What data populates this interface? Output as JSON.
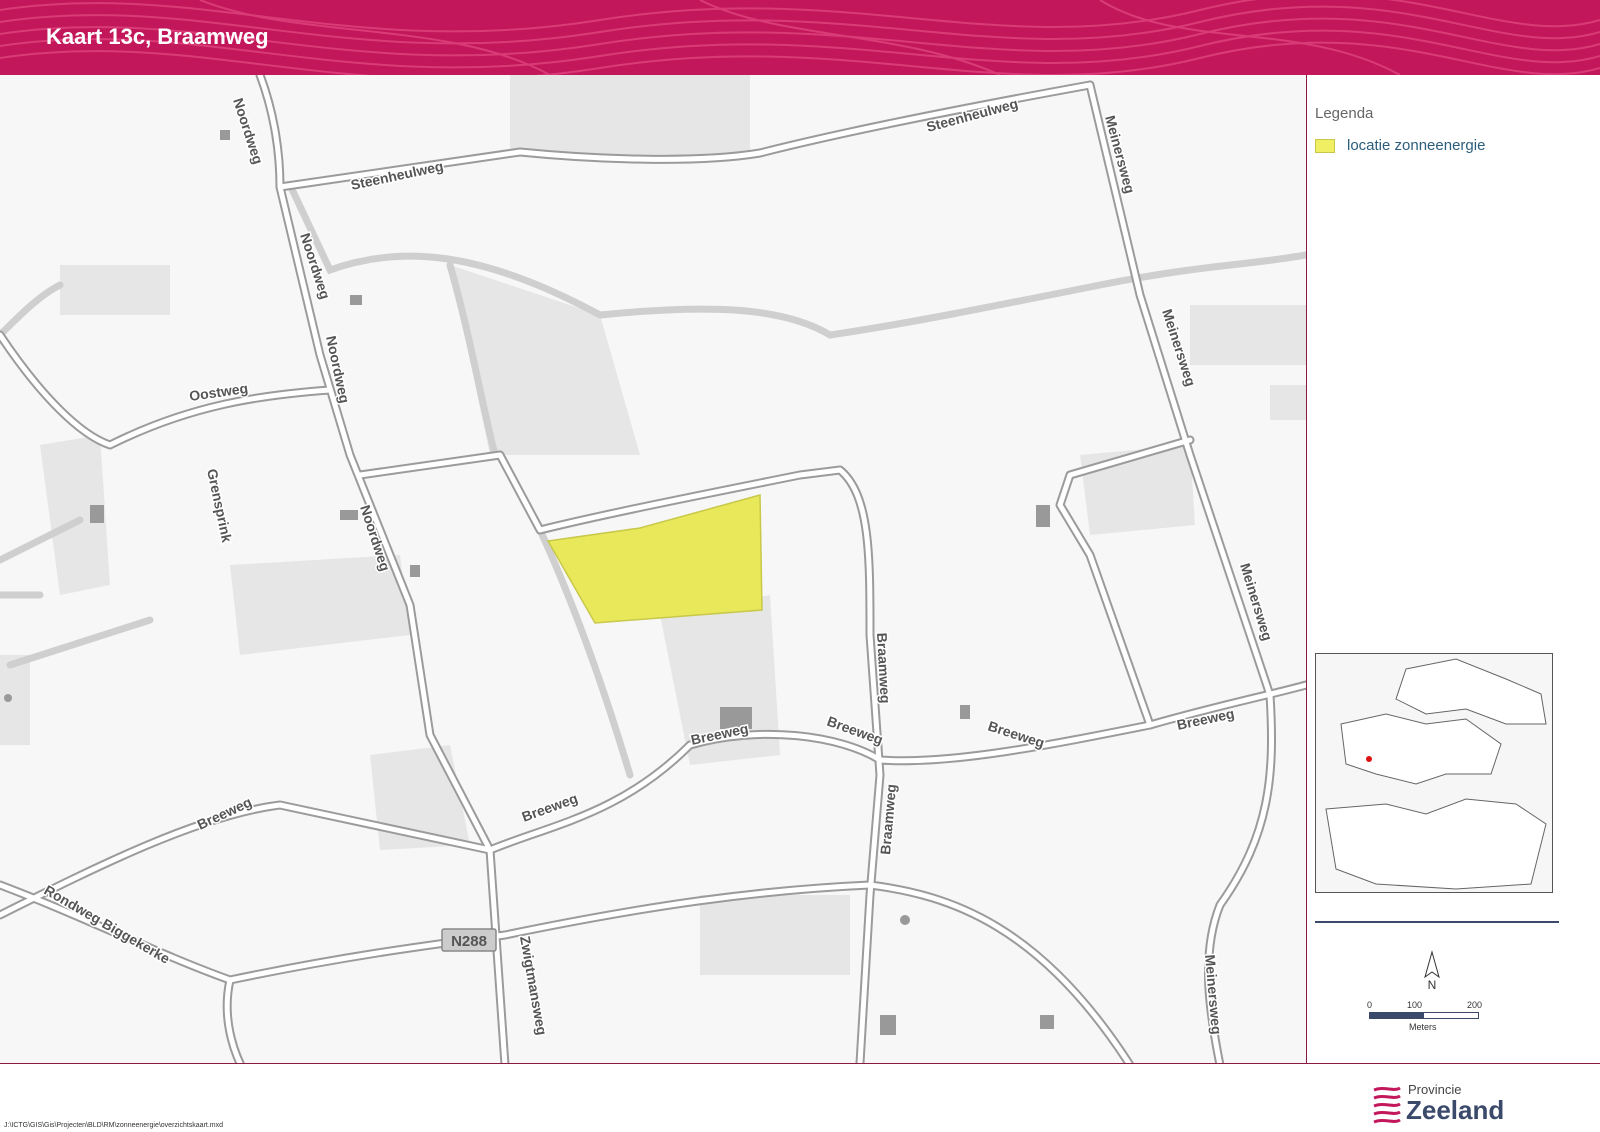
{
  "header": {
    "title": "Kaart 13c, Braamweg"
  },
  "map": {
    "road_labels": [
      "Steenheulweg",
      "Steenheulweg",
      "Noordweg",
      "Noordweg",
      "Noordweg",
      "Noordweg",
      "Oostweg",
      "Grensprink",
      "Meinersweg",
      "Meinersweg",
      "Meinersweg",
      "Meinersweg",
      "Braamweg",
      "Braamweg",
      "Breeweg",
      "Breeweg",
      "Breeweg",
      "Breeweg",
      "Breeweg",
      "Breeweg",
      "Rondweg Biggekerke",
      "Zwigtmansweg",
      "N288"
    ],
    "highlight_color": "#e8e85a"
  },
  "legend": {
    "title": "Legenda",
    "item_label": "locatie zonneenergie",
    "item_color": "#f0ef63"
  },
  "north": {
    "label": "N"
  },
  "scale": {
    "ticks": [
      "0",
      "100",
      "200"
    ],
    "units": "Meters"
  },
  "footer": {
    "filepath": "J:\\ICTG\\GIS\\Gis\\Projecten\\BLD\\RM\\zonneenergie\\overzichtskaart.mxd"
  },
  "logo": {
    "provincie": "Provincie",
    "name": "Zeeland"
  },
  "colors": {
    "header": "#c2185b",
    "border": "#8a1a44"
  }
}
